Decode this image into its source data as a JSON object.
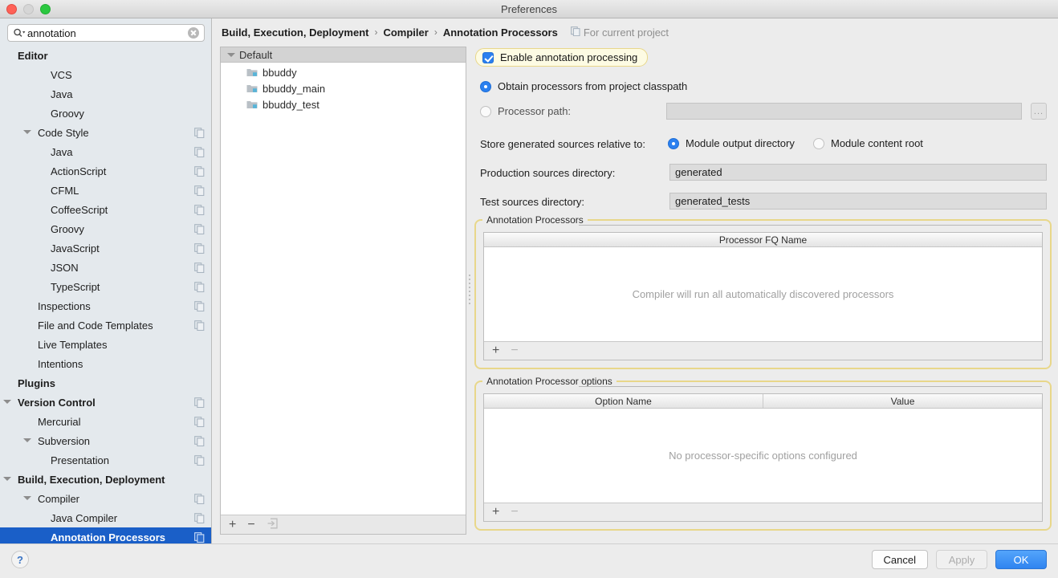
{
  "window": {
    "title": "Preferences"
  },
  "search": {
    "value": "annotation",
    "icon": "search-icon",
    "clear_icon": "clear-icon"
  },
  "sidebar": {
    "items": [
      {
        "label": "Editor",
        "indent": 0,
        "bold": true,
        "arrow": false,
        "copy": false,
        "selected": false
      },
      {
        "label": "VCS",
        "indent": 2,
        "bold": false,
        "arrow": false,
        "copy": false,
        "selected": false
      },
      {
        "label": "Java",
        "indent": 2,
        "bold": false,
        "arrow": false,
        "copy": false,
        "selected": false
      },
      {
        "label": "Groovy",
        "indent": 2,
        "bold": false,
        "arrow": false,
        "copy": false,
        "selected": false
      },
      {
        "label": "Code Style",
        "indent": 1,
        "bold": false,
        "arrow": true,
        "copy": true,
        "selected": false
      },
      {
        "label": "Java",
        "indent": 2,
        "bold": false,
        "arrow": false,
        "copy": true,
        "selected": false
      },
      {
        "label": "ActionScript",
        "indent": 2,
        "bold": false,
        "arrow": false,
        "copy": true,
        "selected": false
      },
      {
        "label": "CFML",
        "indent": 2,
        "bold": false,
        "arrow": false,
        "copy": true,
        "selected": false
      },
      {
        "label": "CoffeeScript",
        "indent": 2,
        "bold": false,
        "arrow": false,
        "copy": true,
        "selected": false
      },
      {
        "label": "Groovy",
        "indent": 2,
        "bold": false,
        "arrow": false,
        "copy": true,
        "selected": false
      },
      {
        "label": "JavaScript",
        "indent": 2,
        "bold": false,
        "arrow": false,
        "copy": true,
        "selected": false
      },
      {
        "label": "JSON",
        "indent": 2,
        "bold": false,
        "arrow": false,
        "copy": true,
        "selected": false
      },
      {
        "label": "TypeScript",
        "indent": 2,
        "bold": false,
        "arrow": false,
        "copy": true,
        "selected": false
      },
      {
        "label": "Inspections",
        "indent": 1,
        "bold": false,
        "arrow": false,
        "copy": true,
        "selected": false
      },
      {
        "label": "File and Code Templates",
        "indent": 1,
        "bold": false,
        "arrow": false,
        "copy": true,
        "selected": false
      },
      {
        "label": "Live Templates",
        "indent": 1,
        "bold": false,
        "arrow": false,
        "copy": false,
        "selected": false
      },
      {
        "label": "Intentions",
        "indent": 1,
        "bold": false,
        "arrow": false,
        "copy": false,
        "selected": false
      },
      {
        "label": "Plugins",
        "indent": 0,
        "bold": true,
        "arrow": false,
        "copy": false,
        "selected": false
      },
      {
        "label": "Version Control",
        "indent": 0,
        "bold": true,
        "arrow": true,
        "copy": true,
        "selected": false
      },
      {
        "label": "Mercurial",
        "indent": 1,
        "bold": false,
        "arrow": false,
        "copy": true,
        "selected": false
      },
      {
        "label": "Subversion",
        "indent": 1,
        "bold": false,
        "arrow": true,
        "copy": true,
        "selected": false
      },
      {
        "label": "Presentation",
        "indent": 2,
        "bold": false,
        "arrow": false,
        "copy": true,
        "selected": false
      },
      {
        "label": "Build, Execution, Deployment",
        "indent": 0,
        "bold": true,
        "arrow": true,
        "copy": false,
        "selected": false
      },
      {
        "label": "Compiler",
        "indent": 1,
        "bold": false,
        "arrow": true,
        "copy": true,
        "selected": false
      },
      {
        "label": "Java Compiler",
        "indent": 2,
        "bold": false,
        "arrow": false,
        "copy": true,
        "selected": false
      },
      {
        "label": "Annotation Processors",
        "indent": 2,
        "bold": true,
        "arrow": false,
        "copy": true,
        "selected": true
      }
    ]
  },
  "breadcrumb": {
    "crumbs": [
      "Build, Execution, Deployment",
      "Compiler",
      "Annotation Processors"
    ],
    "separator": "›",
    "project_note": "For current project",
    "project_note_icon": "copy-icon"
  },
  "modules": {
    "header": "Default",
    "items": [
      {
        "label": "bbuddy",
        "icon": "module-icon"
      },
      {
        "label": "bbuddy_main",
        "icon": "module-icon"
      },
      {
        "label": "bbuddy_test",
        "icon": "module-icon"
      }
    ],
    "toolbar": {
      "add": "+",
      "remove": "−",
      "import": "import-icon"
    }
  },
  "settings": {
    "enable_label": "Enable annotation processing",
    "enable_checked": true,
    "source_options": [
      {
        "label": "Obtain processors from project classpath",
        "selected": true
      },
      {
        "label": "Processor path:",
        "selected": false
      }
    ],
    "processor_path_value": "",
    "browse_label": "...",
    "store_relative_label": "Store generated sources relative to:",
    "store_options": [
      {
        "label": "Module output directory",
        "selected": true
      },
      {
        "label": "Module content root",
        "selected": false
      }
    ],
    "production_label": "Production sources directory:",
    "production_value": "generated",
    "test_label": "Test sources directory:",
    "test_value": "generated_tests"
  },
  "processors_group": {
    "title": "Annotation Processors",
    "columns": [
      "Processor FQ Name"
    ],
    "rows": [],
    "empty_text": "Compiler will run all automatically discovered processors",
    "toolbar": {
      "add": "+",
      "remove": "−"
    }
  },
  "options_group": {
    "title": "Annotation Processor options",
    "columns": [
      "Option Name",
      "Value"
    ],
    "rows": [],
    "empty_text": "No processor-specific options configured",
    "toolbar": {
      "add": "+",
      "remove": "−"
    }
  },
  "footer": {
    "help": "?",
    "cancel": "Cancel",
    "apply": "Apply",
    "ok": "OK"
  },
  "colors": {
    "selection_blue": "#1a5fc8",
    "accent_blue": "#2b80ef",
    "highlight_yellow": "#e8d78a",
    "highlight_fill": "#fdfbe3",
    "sidebar_bg": "#e4e9ed"
  }
}
